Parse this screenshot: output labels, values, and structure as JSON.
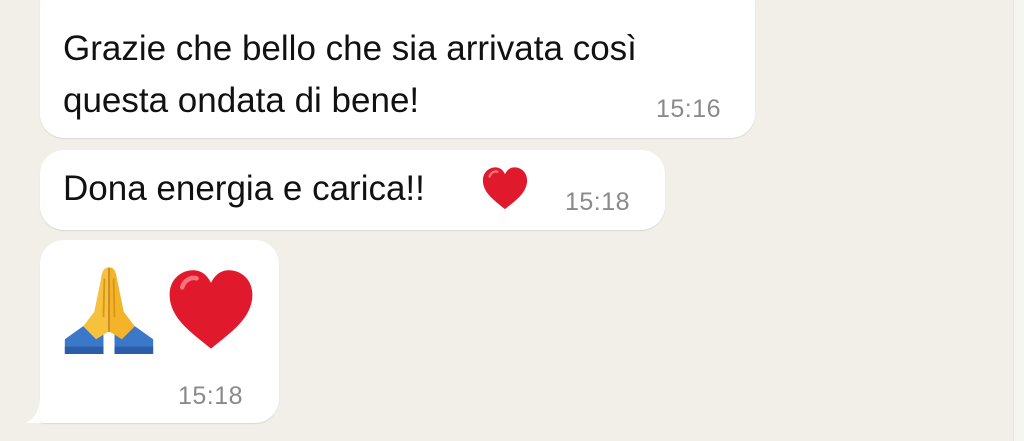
{
  "messages": [
    {
      "lines": [
        "Grazie che bello che sia arrivata così",
        "questa ondata di bene!"
      ],
      "time": "15:16",
      "has_quote": true
    },
    {
      "text": "Dona energia e carica!!",
      "emoji": "red-heart",
      "time": "15:18"
    },
    {
      "emojis": [
        "folded-hands",
        "red-heart"
      ],
      "time": "15:18"
    }
  ],
  "colors": {
    "background": "#f2efe8",
    "bubble": "#ffffff",
    "text": "#111111",
    "timestamp": "#8a8a8a",
    "quote_accent": "#2c6fd8",
    "heart": "#e0192d"
  }
}
